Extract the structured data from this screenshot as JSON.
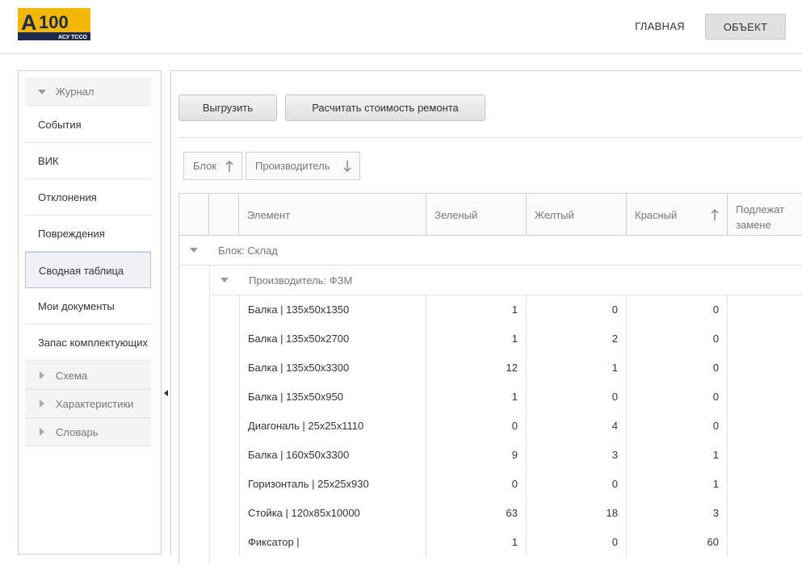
{
  "header": {
    "logo_text": "A100",
    "logo_subtext": "АСУ ТССО",
    "nav": [
      {
        "label": "ГЛАВНАЯ"
      },
      {
        "label": "ОБЪЕКТ"
      }
    ]
  },
  "sidebar": {
    "journal_group": "Журнал",
    "items": [
      {
        "label": "События"
      },
      {
        "label": "ВИК"
      },
      {
        "label": "Отклонения"
      },
      {
        "label": "Повреждения"
      },
      {
        "label": "Сводная таблица"
      },
      {
        "label": "Мои документы"
      },
      {
        "label": "Запас комплектующих"
      }
    ],
    "groups": [
      {
        "label": "Схема"
      },
      {
        "label": "Характеристики"
      },
      {
        "label": "Словарь"
      }
    ]
  },
  "toolbar": {
    "export_label": "Выгрузить",
    "repair_label": "Расчитать стоимость ремонта"
  },
  "sorting": {
    "chips": [
      {
        "label": "Блок",
        "direction": "up"
      },
      {
        "label": "Производитель",
        "direction": "down"
      }
    ]
  },
  "grid": {
    "columns": [
      "Элемент",
      "Зеленый",
      "Желтый",
      "Красный",
      "Подлежат\nзамене"
    ],
    "sorted_column_direction": "up",
    "group_block": "Блок: Склад",
    "group_maker": "Производитель: ФЗМ",
    "rows": [
      {
        "element": "Балка | 135x50x1350",
        "green": "1",
        "yellow": "0",
        "red": "0",
        "replace": ""
      },
      {
        "element": "Балка | 135x50x2700",
        "green": "1",
        "yellow": "2",
        "red": "0",
        "replace": ""
      },
      {
        "element": "Балка | 135x50x3300",
        "green": "12",
        "yellow": "1",
        "red": "0",
        "replace": ""
      },
      {
        "element": "Балка | 135x50x950",
        "green": "1",
        "yellow": "0",
        "red": "0",
        "replace": ""
      },
      {
        "element": "Диагональ | 25x25x1110",
        "green": "0",
        "yellow": "4",
        "red": "0",
        "replace": ""
      },
      {
        "element": "Балка | 160x50x3300",
        "green": "9",
        "yellow": "3",
        "red": "1",
        "replace": ""
      },
      {
        "element": "Горизонталь | 25x25x930",
        "green": "0",
        "yellow": "0",
        "red": "1",
        "replace": ""
      },
      {
        "element": "Стойка | 120x85x10000",
        "green": "63",
        "yellow": "18",
        "red": "3",
        "replace": ""
      },
      {
        "element": "Фиксатор |",
        "green": "1",
        "yellow": "0",
        "red": "60",
        "replace": ""
      }
    ]
  },
  "colors": {
    "logo_yellow": "#f2b705",
    "logo_navy": "#1d2b4f",
    "accent_border": "#b9c6d6"
  }
}
